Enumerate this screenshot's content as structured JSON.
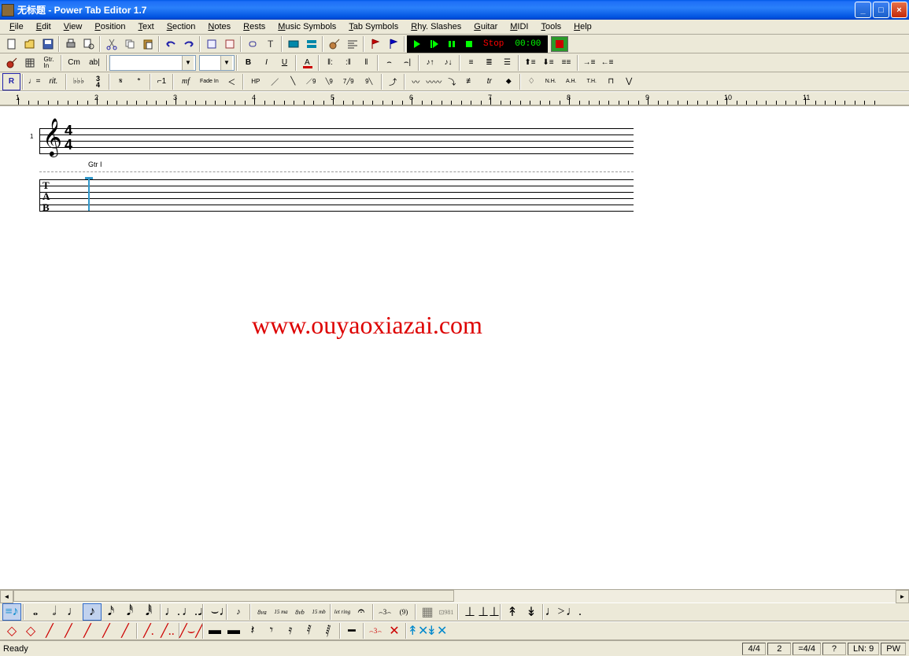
{
  "title": "无标题 - Power Tab Editor 1.7",
  "menu": [
    "File",
    "Edit",
    "View",
    "Position",
    "Text",
    "Section",
    "Notes",
    "Rests",
    "Music Symbols",
    "Tab Symbols",
    "Rhy. Slashes",
    "Guitar",
    "MIDI",
    "Tools",
    "Help"
  ],
  "menu_accel": [
    "F",
    "E",
    "V",
    "P",
    "T",
    "S",
    "N",
    "R",
    "M",
    "T",
    "R",
    "G",
    "M",
    "T",
    "H"
  ],
  "playback": {
    "status": "Stop",
    "time": "00:00"
  },
  "toolbar2": {
    "chord_label": "Cm",
    "text_label": "ab|"
  },
  "style": {
    "bold": "B",
    "italic": "I",
    "underline": "U"
  },
  "ruler": {
    "units": [
      1,
      2,
      3,
      4,
      5,
      6,
      7,
      8,
      9,
      10,
      11
    ]
  },
  "score": {
    "time_sig_top": "4",
    "time_sig_bot": "4",
    "gtr_label": "Gtr I",
    "tab_letters": [
      "T",
      "A",
      "B"
    ],
    "measure_num": "1"
  },
  "watermark": "www.ouyaoxiazai.com",
  "status": {
    "ready": "Ready",
    "sig": "4/4",
    "beat": "2",
    "key": "=4/4",
    "pos": "?",
    "ln": "LN: 9",
    "mode": "PW"
  },
  "tb3_labels": {
    "rit": "rit.",
    "mf": "mf",
    "fade": "Fade\nIn",
    "hp": "HP",
    "nh": "N.H.",
    "ah": "A.H.",
    "th": "T.H.",
    "tr": "tr"
  },
  "tb4_labels": {
    "ottava": "8va",
    "quindma": "15\nma",
    "ottavab": "8vb",
    "quindmb": "15\nmb",
    "letring": "let\nring"
  }
}
